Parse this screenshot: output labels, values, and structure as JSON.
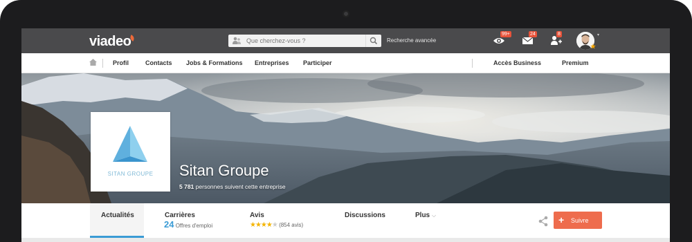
{
  "topbar": {
    "logo": "viadeo",
    "search_placeholder": "Que cherchez-vous ?",
    "advanced_search": "Recherche avancée",
    "views_badge": "99+",
    "messages_badge": "24",
    "invites_badge": "8"
  },
  "nav": {
    "items": [
      "Profil",
      "Contacts",
      "Jobs & Formations",
      "Entreprises",
      "Participer"
    ],
    "business": "Accès Business",
    "premium": "Premium"
  },
  "company": {
    "logo_text": "SITAN GROUPE",
    "name": "Sitan Groupe",
    "followers_count": "5 781",
    "followers_text": "personnes suivent cette entreprise"
  },
  "tabs": {
    "news": "Actualités",
    "careers": "Carrières",
    "careers_count": "24",
    "careers_sub": "Offres d'emploi",
    "reviews": "Avis",
    "reviews_rating": 4,
    "reviews_count": "(854 avis)",
    "discussions": "Discussions",
    "more": "Plus"
  },
  "follow_button": "Suivre",
  "colors": {
    "accent": "#3a9bd5",
    "follow": "#ee6c4d",
    "badge": "#e8533a",
    "topbar": "#4a4a4c"
  }
}
